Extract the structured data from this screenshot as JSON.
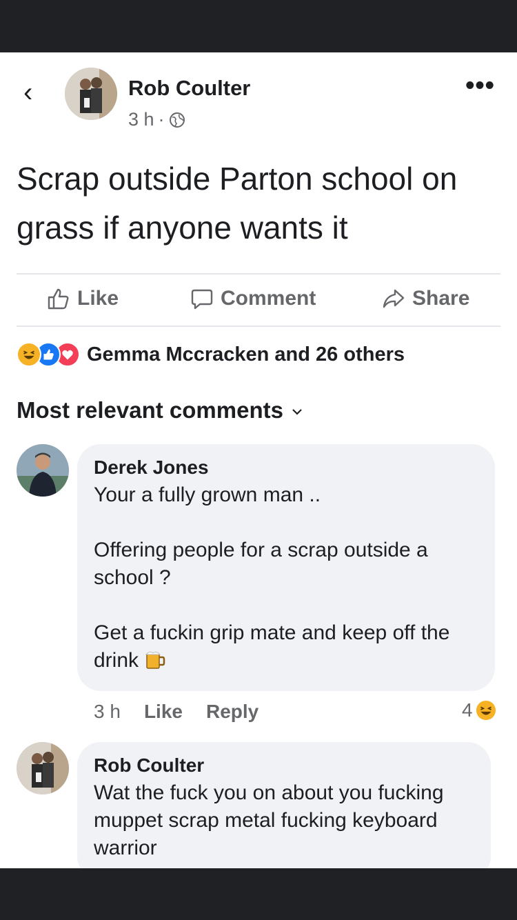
{
  "post": {
    "back_icon": "‹",
    "author": "Rob Coulter",
    "time": "3 h",
    "separator": "·",
    "more_icon": "•••",
    "text": "Scrap outside Parton school on grass if anyone wants it"
  },
  "actions": {
    "like": "Like",
    "comment": "Comment",
    "share": "Share"
  },
  "reactions": {
    "names": "Gemma Mccracken and 26 others",
    "colors": {
      "haha": "#f7b125",
      "like": "#1877f2",
      "love": "#f33e58"
    }
  },
  "comments_header": "Most relevant comments",
  "comments": [
    {
      "name": "Derek Jones",
      "text": "Your a fully grown man ..\n\nOffering people for a scrap outside a school ?\n\nGet a fuckin grip mate and keep off the drink",
      "time": "3 h",
      "like": "Like",
      "reply": "Reply",
      "reaction_count": "4"
    },
    {
      "name": "Rob Coulter",
      "text": "Wat the fuck you on about you fucking muppet scrap metal fucking keyboard warrior"
    }
  ]
}
